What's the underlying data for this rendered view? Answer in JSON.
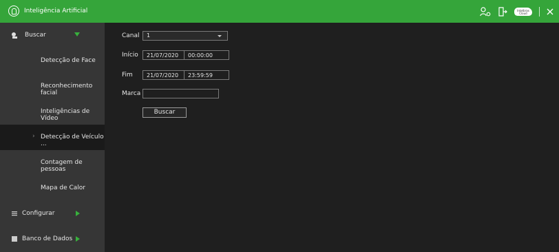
{
  "header": {
    "title": "Inteligência Artificial",
    "icons": [
      "user-settings-icon",
      "logout-icon",
      "cloud-icon",
      "close-icon"
    ],
    "cloud_label": "Intelbras Cloud",
    "accent_color": "#35a53a"
  },
  "sidebar": {
    "items": [
      {
        "label": "Buscar",
        "icon": "search-camera-icon",
        "expanded": true
      },
      {
        "label": "Detecção de Face"
      },
      {
        "label": "Reconhecimento facial"
      },
      {
        "label": "Inteligências de Vídeo"
      },
      {
        "label": "Detecção de Veículo ...",
        "active": true
      },
      {
        "label": "Contagem de pessoas"
      },
      {
        "label": "Mapa de Calor"
      },
      {
        "label": "Configurar",
        "icon": "list-icon"
      },
      {
        "label": "Banco de Dados",
        "icon": "database-icon"
      }
    ]
  },
  "form": {
    "canal_label": "Canal",
    "canal_value": "1",
    "inicio_label": "Início",
    "inicio_date": "21/07/2020",
    "inicio_time": "00:00:00",
    "fim_label": "Fim",
    "fim_date": "21/07/2020",
    "fim_time": "23:59:59",
    "marca_label": "Marca",
    "marca_value": "",
    "buscar_button": "Buscar"
  }
}
